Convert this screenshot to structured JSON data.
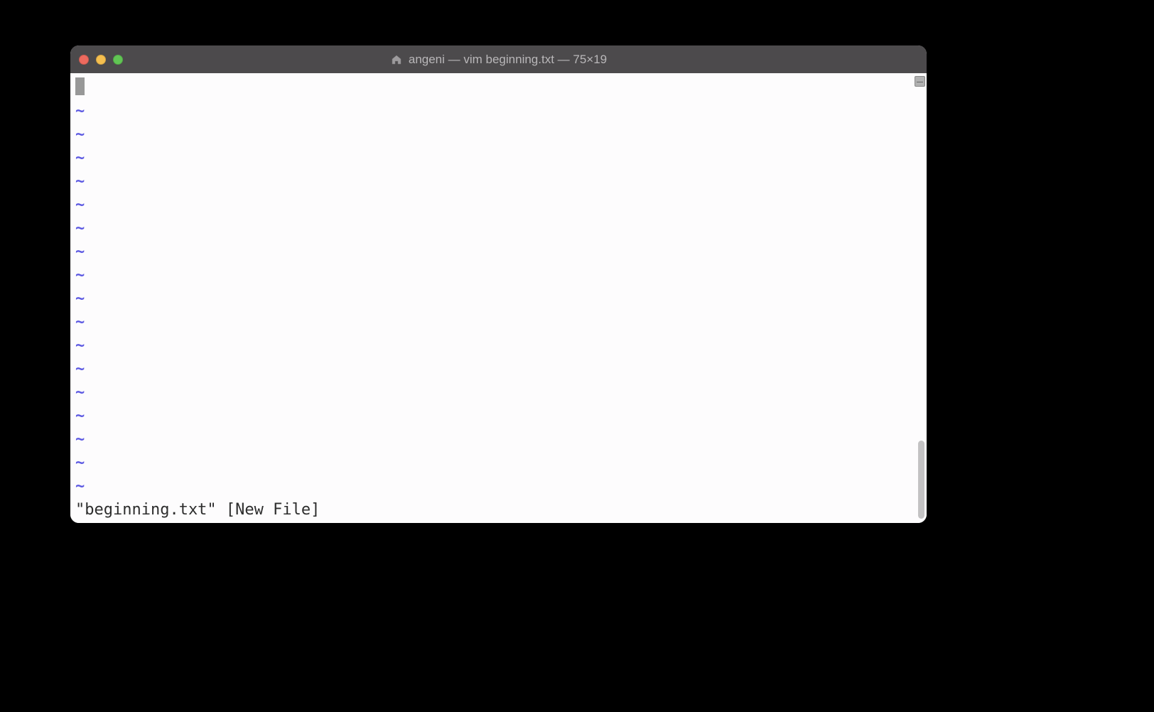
{
  "titlebar": {
    "title": "angeni — vim beginning.txt — 75×19",
    "home_icon": "home-icon"
  },
  "editor": {
    "tilde": "~",
    "tilde_count": 17,
    "status_line": "\"beginning.txt\" [New File]"
  }
}
